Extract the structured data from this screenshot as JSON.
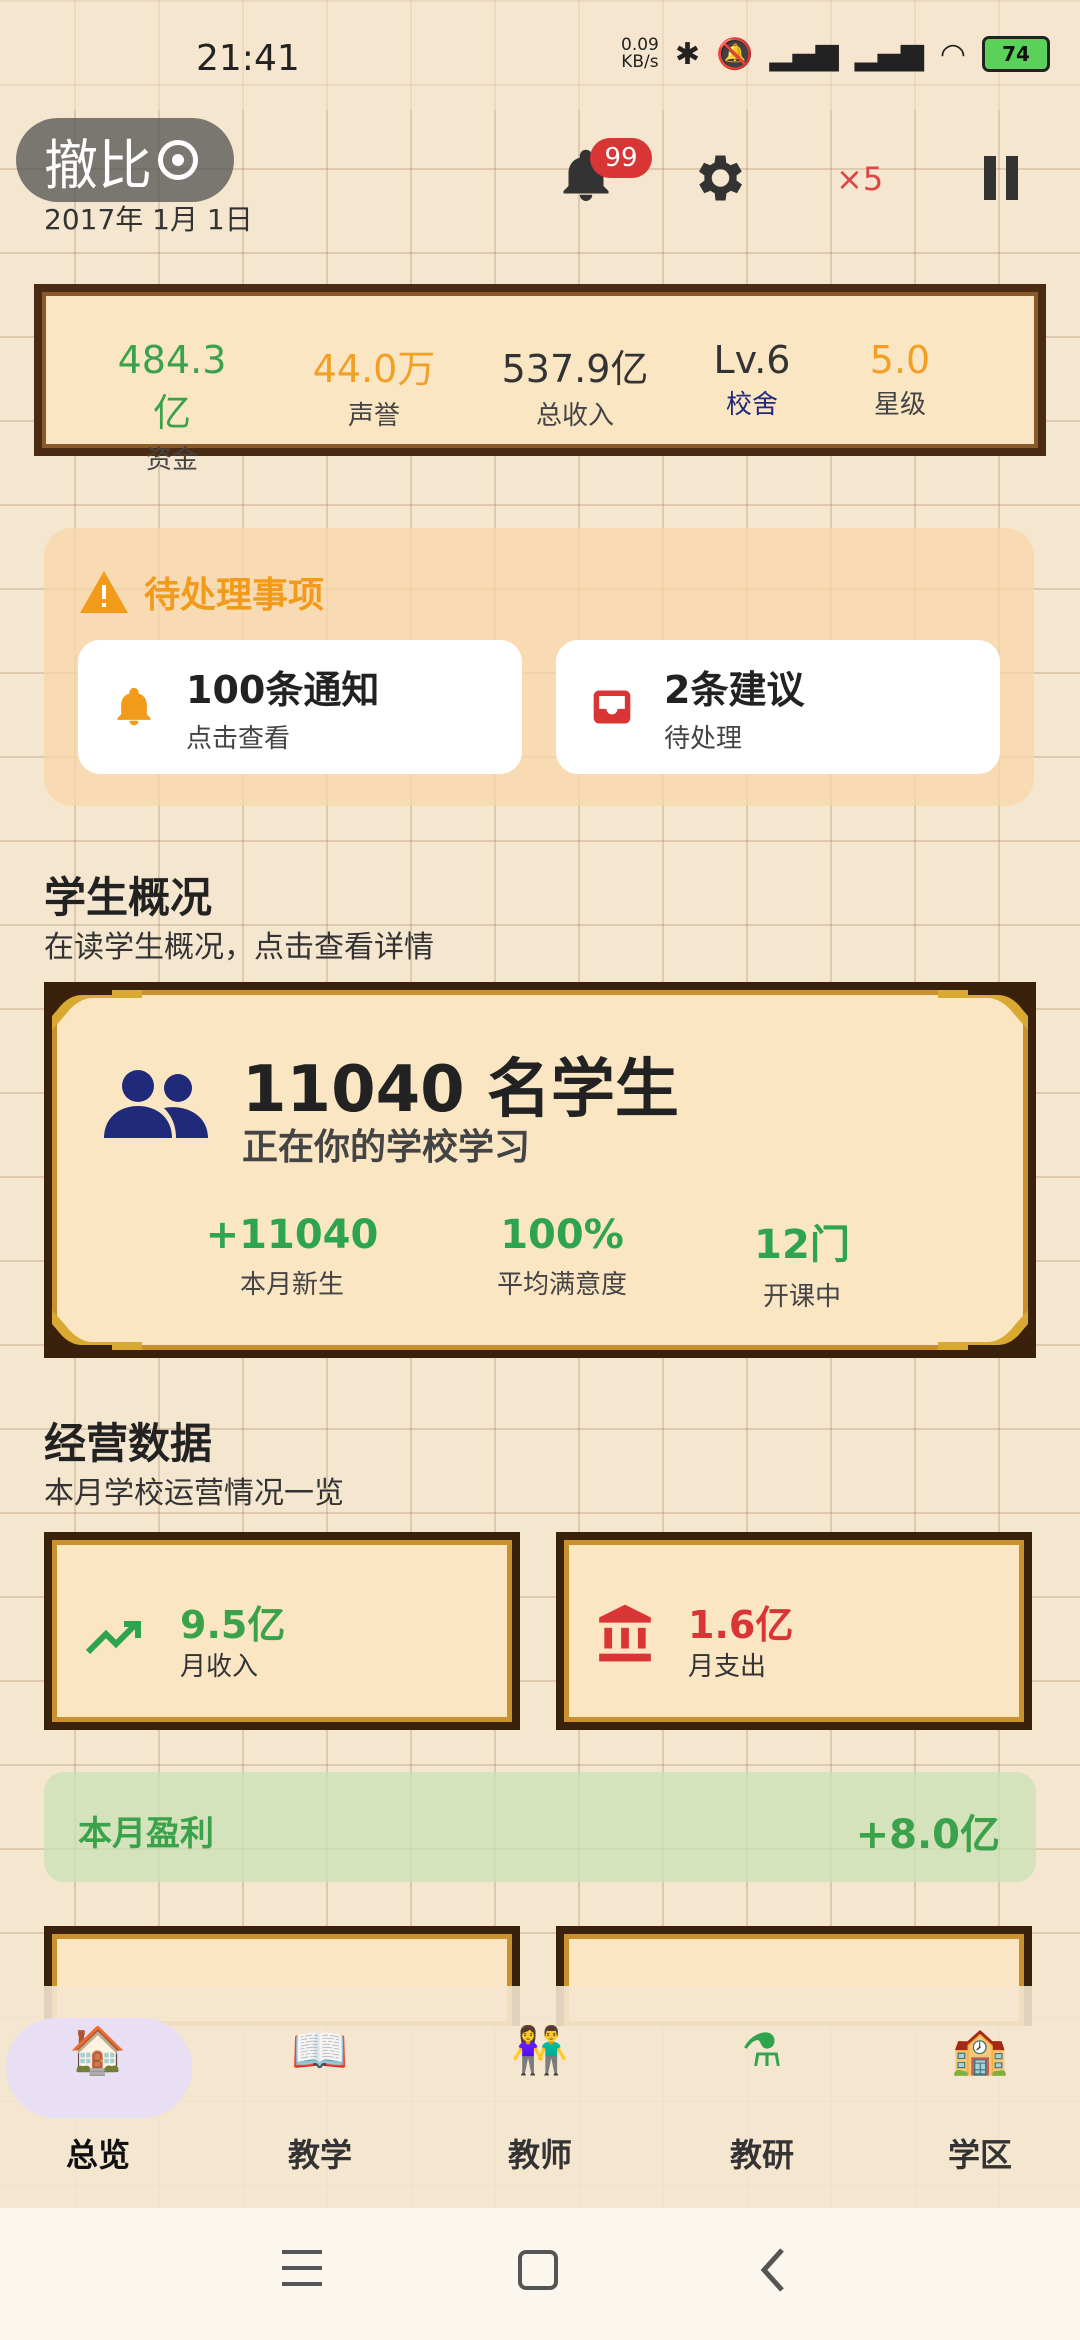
{
  "status": {
    "time": "21:41",
    "netspeed_top": "0.09",
    "netspeed_bottom": "KB/s",
    "battery": "74"
  },
  "header": {
    "pill_text": "撤比",
    "date": "2017年 1月 1日",
    "notif_badge": "99",
    "speed": "×5"
  },
  "stats": [
    {
      "value": "484.3亿",
      "label": "资金",
      "color": "#3aa24a"
    },
    {
      "value": "44.0万",
      "label": "声誉",
      "color": "#f2a024"
    },
    {
      "value": "537.9亿",
      "label": "总收入",
      "color": "#333333"
    },
    {
      "value": "Lv.6",
      "label": "校舍",
      "color": "#333333",
      "label_color": "#1f2a7a"
    },
    {
      "value": "5.0",
      "label": "星级",
      "color": "#f2a024"
    }
  ],
  "pending": {
    "title": "待处理事项",
    "items": [
      {
        "title": "100条通知",
        "sub": "点击查看",
        "icon": "bell-icon"
      },
      {
        "title": "2条建议",
        "sub": "待处理",
        "icon": "inbox-icon"
      }
    ]
  },
  "students": {
    "title": "学生概况",
    "subtitle": "在读学生概况，点击查看详情",
    "count": "11040 名学生",
    "desc": "正在你的学校学习",
    "metrics": [
      {
        "value": "+11040",
        "label": "本月新生"
      },
      {
        "value": "100%",
        "label": "平均满意度"
      },
      {
        "value": "12门",
        "label": "开课中"
      }
    ]
  },
  "business": {
    "title": "经营数据",
    "subtitle": "本月学校运营情况一览",
    "income": {
      "value": "9.5亿",
      "label": "月收入",
      "color": "#3aa24a"
    },
    "expense": {
      "value": "1.6亿",
      "label": "月支出",
      "color": "#d93535"
    },
    "profit_label": "本月盈利",
    "profit_value": "+8.0亿"
  },
  "nav": [
    {
      "label": "总览",
      "icon": "school-house-icon",
      "glyph": "🏠"
    },
    {
      "label": "教学",
      "icon": "book-icon",
      "glyph": "📖"
    },
    {
      "label": "教师",
      "icon": "teachers-icon",
      "glyph": "👫"
    },
    {
      "label": "教研",
      "icon": "flask-icon",
      "glyph": "⚗"
    },
    {
      "label": "学区",
      "icon": "school-building-icon",
      "glyph": "🏫"
    }
  ]
}
